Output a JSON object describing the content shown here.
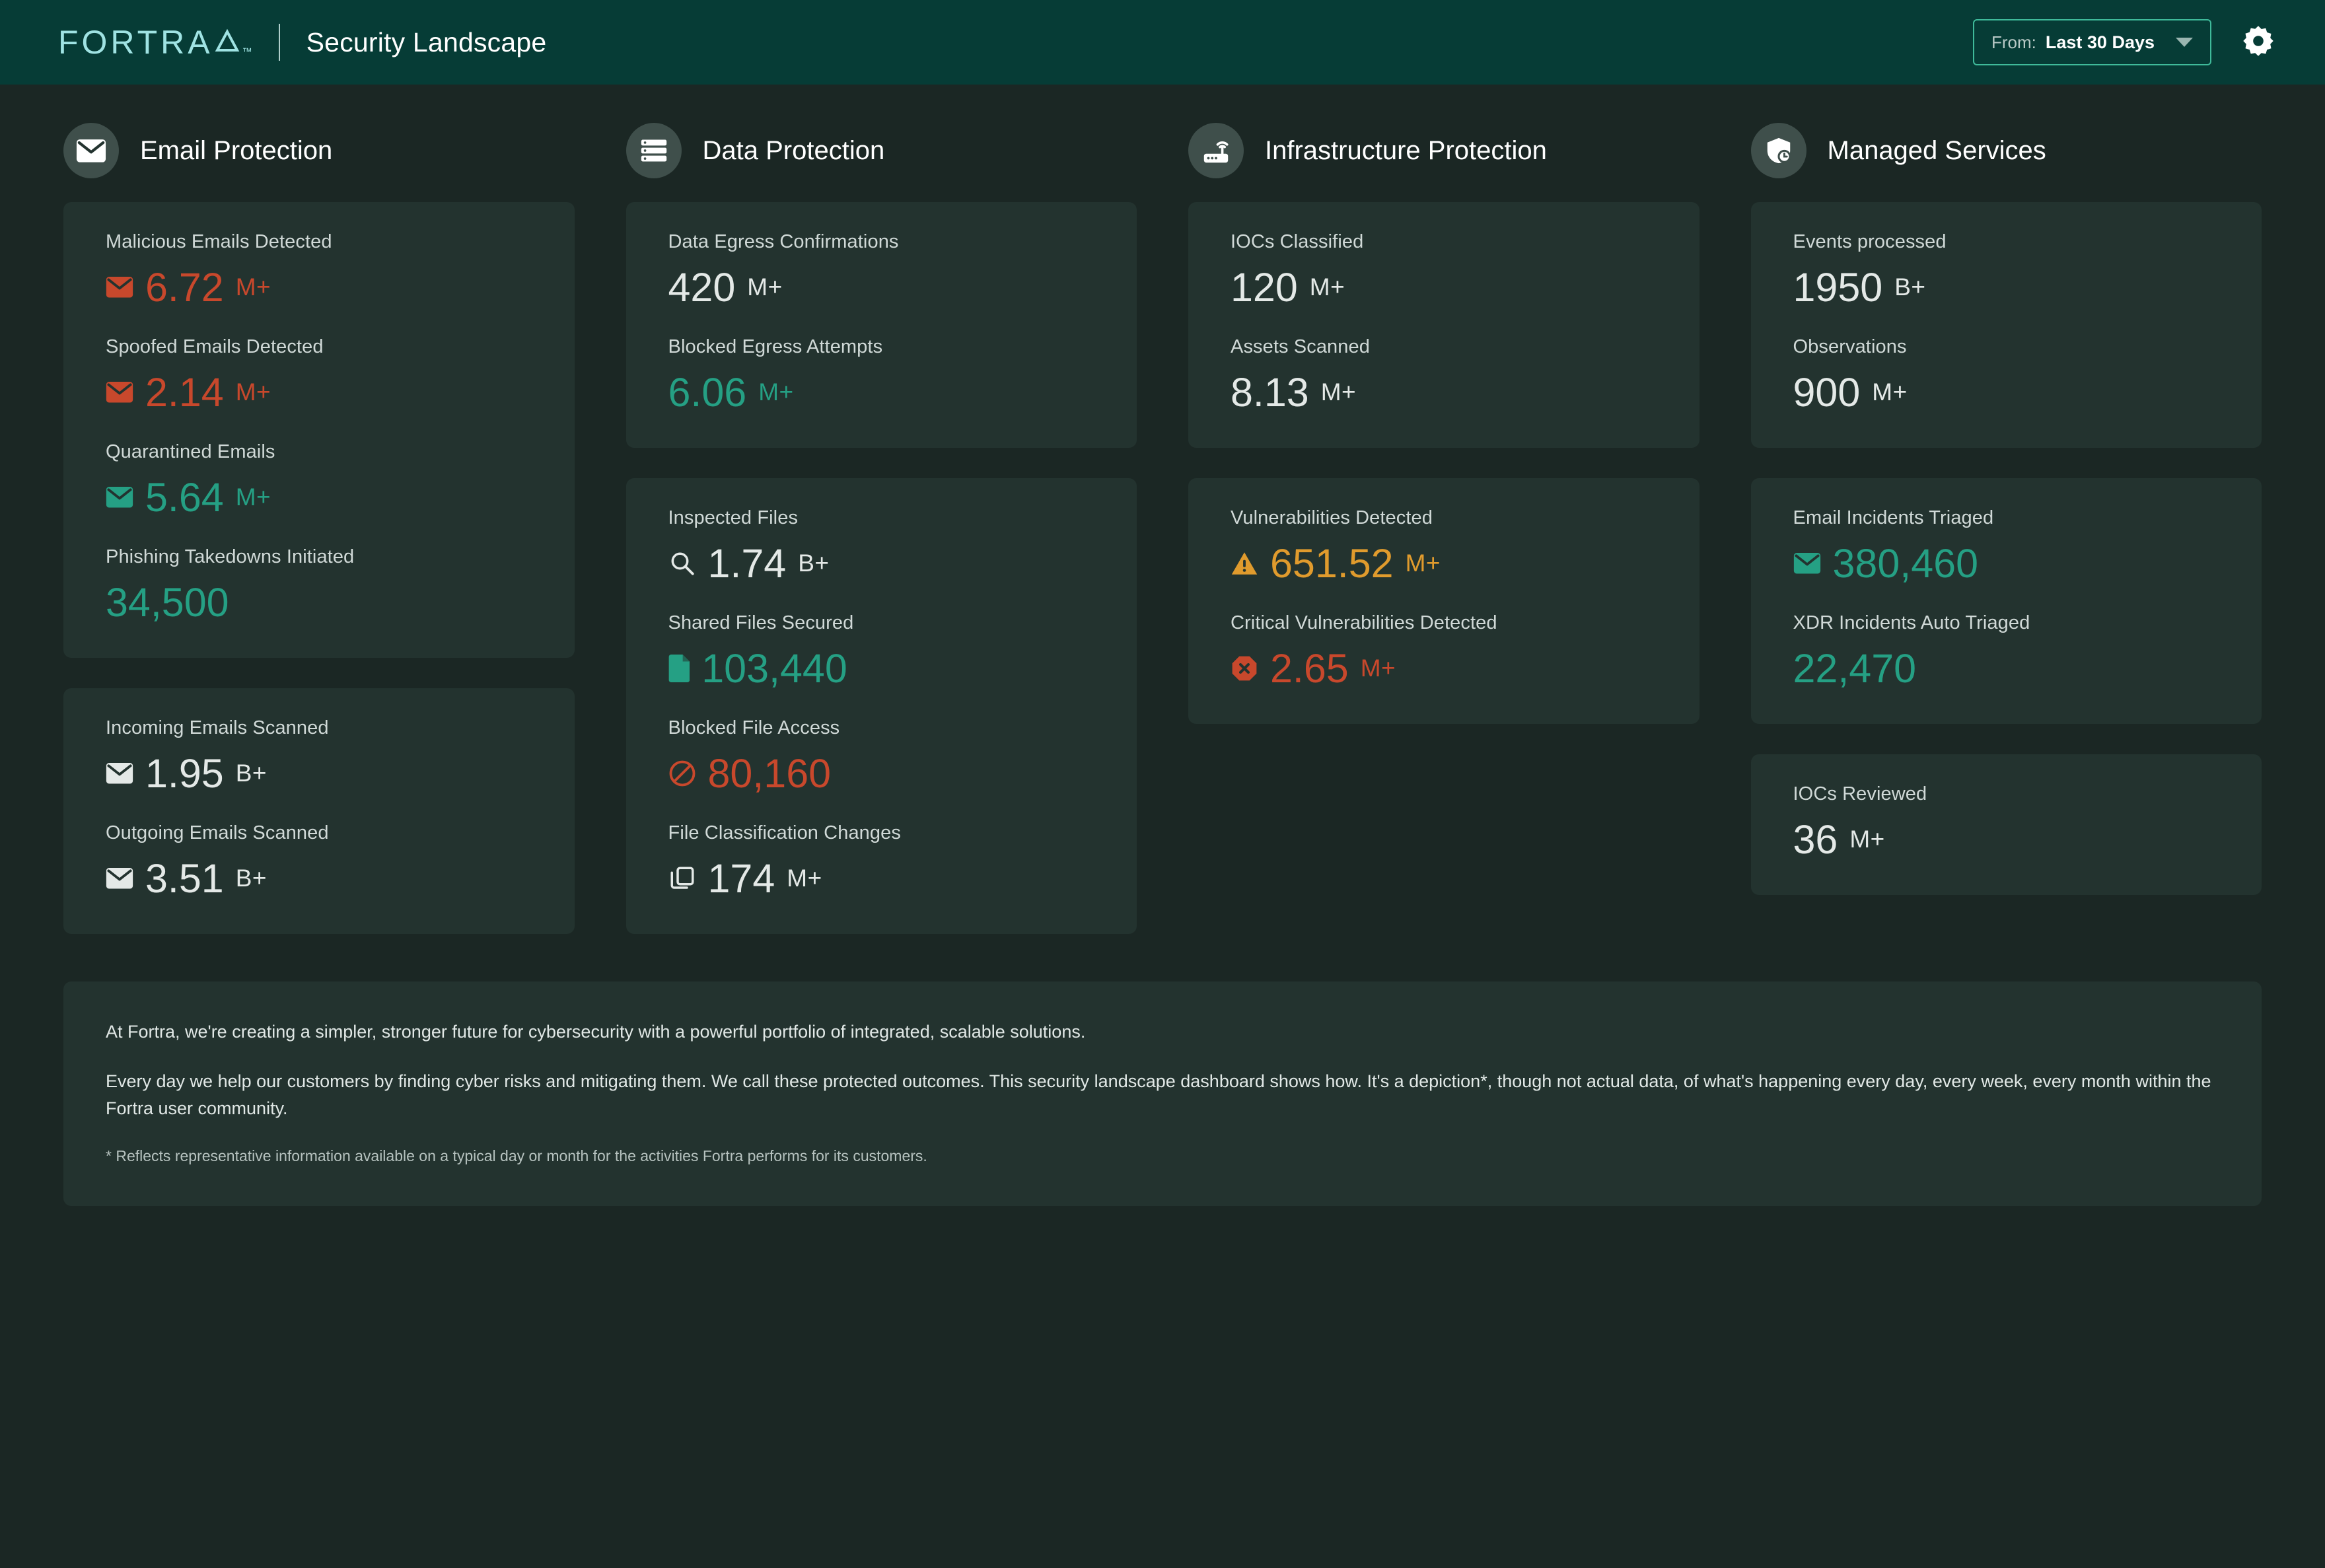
{
  "header": {
    "logo": "FORTRA",
    "logo_tm": "™",
    "app_title": "Security Landscape",
    "range_from_label": "From:",
    "range_value": "Last 30 Days",
    "gear_label": "Settings"
  },
  "colors": {
    "header_bg": "#063c36",
    "page_bg": "#1b2724",
    "card_bg": "#23332f",
    "accent_logo": "#9fe3e3",
    "red": "#c8482c",
    "green": "#25a084",
    "amber": "#e09b2d",
    "white": "#e4e9e7",
    "select_border": "#3fba9a"
  },
  "columns": [
    {
      "id": "email-protection",
      "title": "Email Protection",
      "icon": "envelope-icon",
      "cards": [
        {
          "metrics": [
            {
              "label": "Malicious Emails Detected",
              "icon": "envelope-icon",
              "value": "6.72",
              "suffix": "M+",
              "color": "red"
            },
            {
              "label": "Spoofed Emails Detected",
              "icon": "envelope-icon",
              "value": "2.14",
              "suffix": "M+",
              "color": "red"
            },
            {
              "label": "Quarantined Emails",
              "icon": "envelope-icon",
              "value": "5.64",
              "suffix": "M+",
              "color": "green"
            },
            {
              "label": "Phishing Takedowns Initiated",
              "icon": "none",
              "value": "34,500",
              "suffix": "",
              "color": "green"
            }
          ]
        },
        {
          "metrics": [
            {
              "label": "Incoming Emails Scanned",
              "icon": "envelope-icon",
              "value": "1.95",
              "suffix": "B+",
              "color": "white"
            },
            {
              "label": "Outgoing Emails Scanned",
              "icon": "envelope-icon",
              "value": "3.51",
              "suffix": "B+",
              "color": "white"
            }
          ]
        }
      ]
    },
    {
      "id": "data-protection",
      "title": "Data Protection",
      "icon": "database-icon",
      "cards": [
        {
          "metrics": [
            {
              "label": "Data Egress Confirmations",
              "icon": "none",
              "value": "420",
              "suffix": "M+",
              "color": "white"
            },
            {
              "label": "Blocked Egress Attempts",
              "icon": "none",
              "value": "6.06",
              "suffix": "M+",
              "color": "green"
            }
          ]
        },
        {
          "metrics": [
            {
              "label": "Inspected Files",
              "icon": "search-icon",
              "value": "1.74",
              "suffix": "B+",
              "color": "white"
            },
            {
              "label": "Shared Files Secured",
              "icon": "file-icon",
              "value": "103,440",
              "suffix": "",
              "color": "green"
            },
            {
              "label": "Blocked File Access",
              "icon": "ban-icon",
              "value": "80,160",
              "suffix": "",
              "color": "red"
            },
            {
              "label": "File Classification Changes",
              "icon": "copy-icon",
              "value": "174",
              "suffix": "M+",
              "color": "white"
            }
          ]
        }
      ]
    },
    {
      "id": "infrastructure-protection",
      "title": "Infrastructure Protection",
      "icon": "router-icon",
      "cards": [
        {
          "metrics": [
            {
              "label": "IOCs Classified",
              "icon": "none",
              "value": "120",
              "suffix": "M+",
              "color": "white"
            },
            {
              "label": "Assets Scanned",
              "icon": "none",
              "value": "8.13",
              "suffix": "M+",
              "color": "white"
            }
          ]
        },
        {
          "metrics": [
            {
              "label": "Vulnerabilities Detected",
              "icon": "warning-triangle-icon",
              "value": "651.52",
              "suffix": "M+",
              "color": "amber"
            },
            {
              "label": "Critical Vulnerabilities Detected",
              "icon": "error-octagon-icon",
              "value": "2.65",
              "suffix": "M+",
              "color": "red"
            }
          ]
        }
      ]
    },
    {
      "id": "managed-services",
      "title": "Managed Services",
      "icon": "shield-clock-icon",
      "cards": [
        {
          "metrics": [
            {
              "label": "Events processed",
              "icon": "none",
              "value": "1950",
              "suffix": "B+",
              "color": "white"
            },
            {
              "label": "Observations",
              "icon": "none",
              "value": "900",
              "suffix": "M+",
              "color": "white"
            }
          ]
        },
        {
          "metrics": [
            {
              "label": "Email Incidents Triaged",
              "icon": "envelope-icon",
              "value": "380,460",
              "suffix": "",
              "color": "green"
            },
            {
              "label": "XDR Incidents Auto Triaged",
              "icon": "none",
              "value": "22,470",
              "suffix": "",
              "color": "green"
            }
          ]
        },
        {
          "metrics": [
            {
              "label": "IOCs Reviewed",
              "icon": "none",
              "value": "36",
              "suffix": "M+",
              "color": "white"
            }
          ]
        }
      ]
    }
  ],
  "footer": {
    "paragraph1": "At Fortra, we're creating a simpler, stronger future for cybersecurity with a powerful portfolio of integrated, scalable solutions.",
    "paragraph2": "Every day we help our customers by finding cyber risks and mitigating them. We call these protected outcomes. This security landscape dashboard shows how. It's a depiction*, though not actual data, of what's happening every day, every week, every month within the Fortra user community.",
    "note": "* Reflects representative information available on a typical day or month for the activities Fortra performs for its customers."
  }
}
